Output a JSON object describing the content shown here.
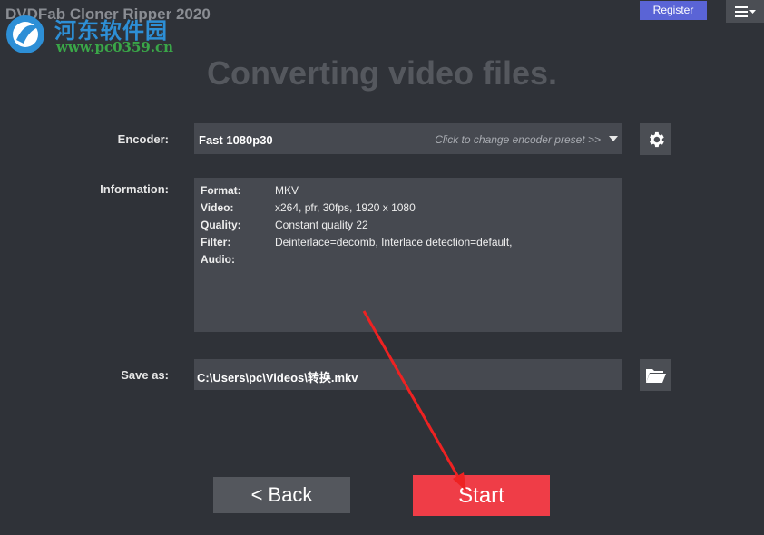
{
  "app": {
    "title": "DVDFab Cloner Ripper 2020"
  },
  "watermark": {
    "logo_text": "河东软件园",
    "url": "www.pc0359.cn"
  },
  "header": {
    "register_label": "Register"
  },
  "main": {
    "heading": "Converting video files.",
    "encoder": {
      "label": "Encoder:",
      "value": "Fast 1080p30",
      "hint": "Click to change encoder preset >>"
    },
    "information": {
      "label": "Information:",
      "rows": [
        {
          "key": "Format:",
          "value": "MKV"
        },
        {
          "key": "Video:",
          "value": "x264, pfr, 30fps, 1920 x 1080"
        },
        {
          "key": "Quality:",
          "value": "Constant quality 22"
        },
        {
          "key": "Filter:",
          "value": "Deinterlace=decomb, Interlace detection=default,"
        },
        {
          "key": "Audio:",
          "value": ""
        }
      ]
    },
    "save_as": {
      "label": "Save as:",
      "value": "C:\\Users\\pc\\Videos\\转换.mkv"
    }
  },
  "footer": {
    "back_label": "<  Back",
    "start_label": "Start"
  },
  "icons": [
    "gear-icon",
    "folder-icon",
    "menu-icon"
  ],
  "colors": {
    "background": "#2f3238",
    "start": "#ef3d47",
    "register": "#5a64d6",
    "annotation_arrow": "#ee2222"
  }
}
